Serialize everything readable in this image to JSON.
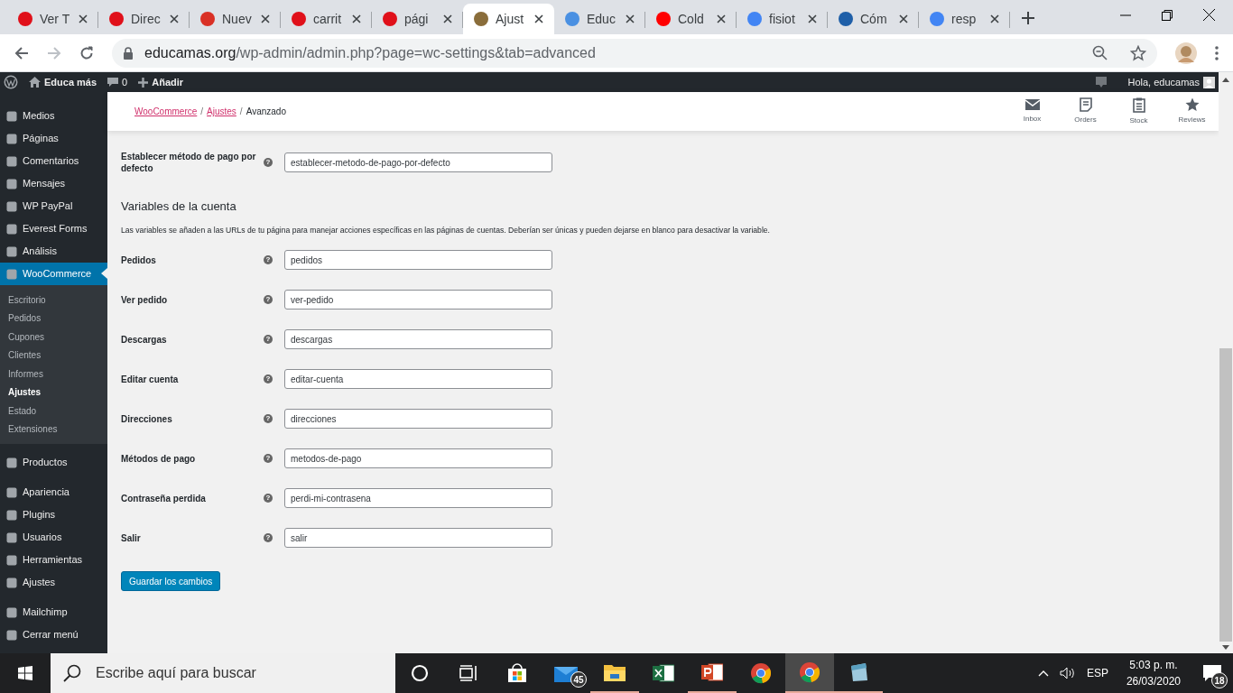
{
  "browser": {
    "tabs": [
      {
        "title": "Ver T",
        "color": "#e0101a",
        "selected": false
      },
      {
        "title": "Direc",
        "color": "#e0101a",
        "selected": false
      },
      {
        "title": "Nuev",
        "color": "#d93025",
        "selected": false
      },
      {
        "title": "carrit",
        "color": "#e0101a",
        "selected": false
      },
      {
        "title": "pági",
        "color": "#e0101a",
        "selected": false
      },
      {
        "title": "Ajust",
        "color": "#8a6d3b",
        "selected": true
      },
      {
        "title": "Educ",
        "color": "#4a90e2",
        "selected": false
      },
      {
        "title": "Cold",
        "color": "#ff0000",
        "selected": false
      },
      {
        "title": "fisiot",
        "color": "#4285f4",
        "selected": false
      },
      {
        "title": "Cóm",
        "color": "#1f5fa8",
        "selected": false
      },
      {
        "title": "resp",
        "color": "#4285f4",
        "selected": false
      }
    ],
    "url_host": "educamas.org",
    "url_path": "/wp-admin/admin.php?page=wc-settings&tab=advanced"
  },
  "admin_bar": {
    "site": "Educa más",
    "comments": "0",
    "new": "Añadir",
    "greeting": "Hola, educamas"
  },
  "sidebar": {
    "items": [
      {
        "label": "Medios",
        "selected": false
      },
      {
        "label": "Páginas",
        "selected": false
      },
      {
        "label": "Comentarios",
        "selected": false
      },
      {
        "label": "Mensajes",
        "selected": false
      },
      {
        "label": "WP PayPal",
        "selected": false
      },
      {
        "label": "Everest Forms",
        "selected": false
      },
      {
        "label": "Análisis",
        "selected": false
      },
      {
        "label": "WooCommerce",
        "selected": true,
        "children": [
          {
            "label": "Escritorio",
            "selected": false
          },
          {
            "label": "Pedidos",
            "selected": false
          },
          {
            "label": "Cupones",
            "selected": false
          },
          {
            "label": "Clientes",
            "selected": false
          },
          {
            "label": "Informes",
            "selected": false
          },
          {
            "label": "Ajustes",
            "selected": true
          },
          {
            "label": "Estado",
            "selected": false
          },
          {
            "label": "Extensiones",
            "selected": false
          }
        ]
      },
      {
        "label": "Productos",
        "selected": false
      },
      {
        "label": "Apariencia",
        "selected": false
      },
      {
        "label": "Plugins",
        "selected": false
      },
      {
        "label": "Usuarios",
        "selected": false
      },
      {
        "label": "Herramientas",
        "selected": false
      },
      {
        "label": "Ajustes",
        "selected": false
      },
      {
        "label": "Mailchimp",
        "selected": false
      },
      {
        "label": "Cerrar menú",
        "selected": false
      }
    ]
  },
  "breadcrumb": [
    {
      "label": "WooCommerce",
      "link": true
    },
    {
      "separator": "/",
      "label": "Ajustes",
      "link": true
    },
    {
      "separator": "/",
      "label": "Avanzado",
      "link": false
    }
  ],
  "header_actions": [
    "Inbox",
    "Orders",
    "Stock",
    "Reviews"
  ],
  "top_field": {
    "label": "Establecer método de pago por defecto",
    "value": "establecer-metodo-de-pago-por-defecto",
    "help": "?"
  },
  "section": {
    "title": "Variables de la cuenta",
    "description": "Las variables se añaden a las URLs de tu página para manejar acciones específicas en las páginas de cuentas. Deberían ser únicas y pueden dejarse en blanco para desactivar la variable."
  },
  "fields": [
    {
      "label": "Pedidos",
      "value": "pedidos",
      "help": "?"
    },
    {
      "label": "Ver pedido",
      "value": "ver-pedido",
      "help": "?"
    },
    {
      "label": "Descargas",
      "value": "descargas",
      "help": "?"
    },
    {
      "label": "Editar cuenta",
      "value": "editar-cuenta",
      "help": "?"
    },
    {
      "label": "Direcciones",
      "value": "direcciones",
      "help": "?"
    },
    {
      "label": "Métodos de pago",
      "value": "metodos-de-pago",
      "help": "?"
    },
    {
      "label": "Contraseña perdida",
      "value": "perdi-mi-contrasena",
      "help": "?"
    },
    {
      "label": "Salir",
      "value": "salir",
      "help": "?"
    }
  ],
  "save_button": "Guardar los cambios",
  "taskbar": {
    "search_placeholder": "Escribe aquí para buscar",
    "mail_badge": "45",
    "language": "ESP",
    "time": "5:03 p. m.",
    "date": "26/03/2020",
    "notifications": "18"
  }
}
